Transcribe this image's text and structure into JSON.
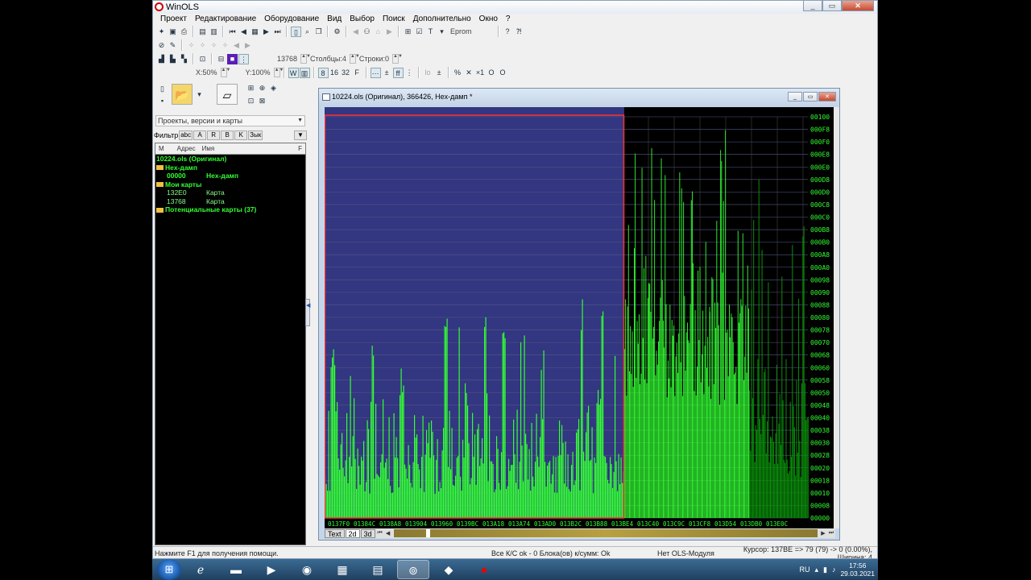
{
  "app": {
    "title": "WinOLS",
    "colors": {
      "graph_green": "#33ff33",
      "graph_bg": "#333680",
      "selection_border": "#ff3030",
      "dark_green": "#0a8f0a"
    }
  },
  "menu": [
    "Проект",
    "Редактирование",
    "Оборудование",
    "Вид",
    "Выбор",
    "Поиск",
    "Дополнительно",
    "Окно",
    "?"
  ],
  "toolbar": {
    "eprom_label": "Eprom",
    "value_13768": "13768",
    "columns": "Столбцы:4",
    "rows": "Строки:0",
    "x_zoom": "X:50%",
    "y_zoom": "Y:100%"
  },
  "left": {
    "combo": "Проекты, версии и карты",
    "filter_label": "Фильтр",
    "filter_btns": [
      "abc",
      "A",
      "R",
      "B",
      "K",
      "Зык"
    ],
    "tree_header": [
      "M",
      "Адрес",
      "Имя",
      "F"
    ],
    "tree": [
      {
        "indent": 0,
        "text": "10224.ols (Оригинал)",
        "folder": false
      },
      {
        "indent": 0,
        "text": "Hex-дамп",
        "folder": true
      },
      {
        "indent": 1,
        "addr": "00000",
        "name": "Hex-дамп"
      },
      {
        "indent": 0,
        "text": "Мои карты",
        "folder": true
      },
      {
        "indent": 1,
        "addr": "132E0",
        "name": "Карта",
        "color": "#33ff33"
      },
      {
        "indent": 1,
        "addr": "13768",
        "name": "Карта",
        "color": "#33ff33"
      },
      {
        "indent": 0,
        "text": "Потенциальные карты (37)",
        "folder": true
      }
    ]
  },
  "child": {
    "title": "10224.ols (Оригинал), 366426, Hex-дамп *",
    "y_labels": [
      "00100",
      "000F8",
      "000F0",
      "000E8",
      "000E0",
      "000D8",
      "000D0",
      "000C8",
      "000C0",
      "000B8",
      "000B0",
      "000A8",
      "000A0",
      "00098",
      "00090",
      "00088",
      "00080",
      "00078",
      "00070",
      "00068",
      "00060",
      "00058",
      "00050",
      "00048",
      "00040",
      "00038",
      "00030",
      "00028",
      "00020",
      "00018",
      "00010",
      "00008",
      "00000"
    ],
    "x_labels": [
      "0137F0",
      "01384C",
      "0138A8",
      "013904",
      "013960",
      "0139BC",
      "013A18",
      "013A74",
      "013AD0",
      "013B2C",
      "013B88",
      "013BE4",
      "013C40",
      "013C9C",
      "013CF8",
      "013D54",
      "013DB0",
      "013E0C"
    ],
    "tabs": [
      "Text",
      "2d",
      "3d"
    ]
  },
  "status": {
    "help": "Нажмите F1 для получения помощи.",
    "checksum": "Все К/С ok - 0 Блока(ов) к/сумм: Ok",
    "module": "Нет OLS-Модуля",
    "cursor": "Курсор: 137BE => 79 (79) -> 0 (0.00%), Ширина: 4"
  },
  "taskbar": {
    "lang": "RU",
    "time": "17:56",
    "date": "29.03.2021"
  }
}
